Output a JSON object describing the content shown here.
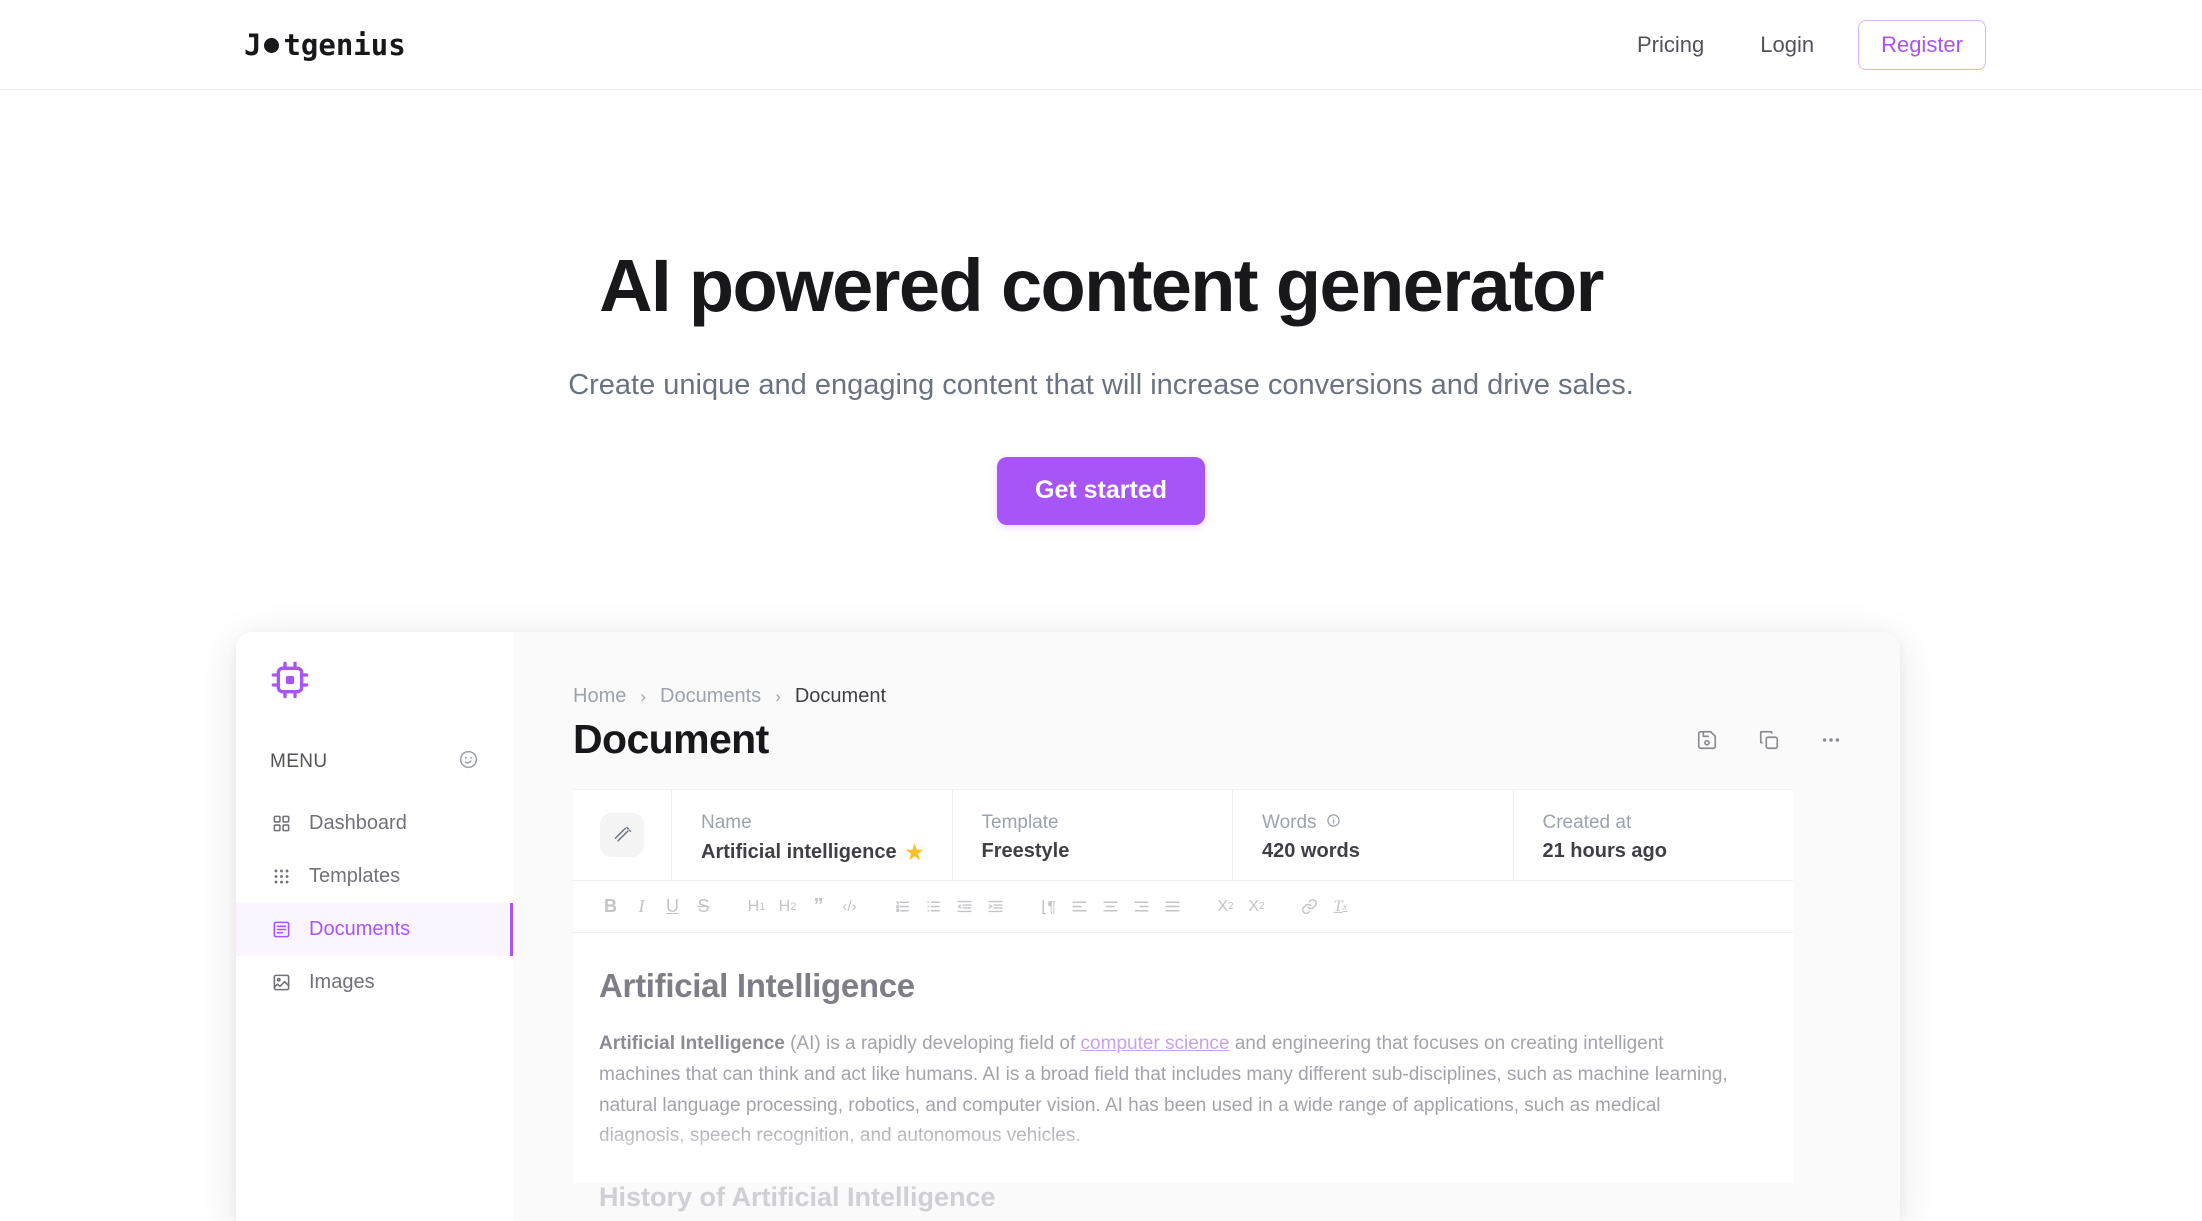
{
  "site": {
    "brand": {
      "prefix": "J",
      "o_icon": "filled-circle",
      "suffix": "tgenius"
    },
    "nav": [
      {
        "label": "Pricing",
        "name": "pricing"
      },
      {
        "label": "Login",
        "name": "login"
      }
    ],
    "register_label": "Register",
    "accent_color": "#a855f7",
    "register_border_color": "#d8b4fe"
  },
  "hero": {
    "title": "AI powered content generator",
    "subtitle": "Create unique and engaging content that will increase conversions and drive sales.",
    "cta_label": "Get started"
  },
  "app": {
    "sidebar": {
      "logo_icon": "cpu-chip-icon",
      "menu_label": "MENU",
      "menu_right_icon": "emoji-face-icon",
      "items": [
        {
          "label": "Dashboard",
          "icon": "grid-icon",
          "active": false
        },
        {
          "label": "Templates",
          "icon": "dots-grid-icon",
          "active": false
        },
        {
          "label": "Documents",
          "icon": "document-list-icon",
          "active": true
        },
        {
          "label": "Images",
          "icon": "image-icon",
          "active": false
        }
      ]
    },
    "breadcrumb": [
      {
        "label": "Home",
        "current": false
      },
      {
        "label": "Documents",
        "current": false
      },
      {
        "label": "Document",
        "current": true
      }
    ],
    "breadcrumb_separator": "›",
    "page_title": "Document",
    "actions": [
      {
        "name": "save-icon",
        "label": "Save"
      },
      {
        "name": "copy-icon",
        "label": "Copy"
      },
      {
        "name": "more-options-icon",
        "label": "More"
      }
    ],
    "info_bar": {
      "leading_icon": "magic-wand-icon",
      "fields": [
        {
          "label": "Name",
          "value": "Artificial intelligence",
          "starred": true,
          "star_glyph": "★"
        },
        {
          "label": "Template",
          "value": "Freestyle",
          "starred": false
        },
        {
          "label": "Words",
          "value": "420 words",
          "starred": false,
          "info_icon": "info-circle-icon"
        },
        {
          "label": "Created at",
          "value": "21 hours ago",
          "starred": false
        }
      ]
    },
    "toolbar": [
      {
        "name": "bold-icon",
        "glyph": "B",
        "style": "bold"
      },
      {
        "name": "italic-icon",
        "glyph": "I",
        "style": "italic"
      },
      {
        "name": "underline-icon",
        "glyph": "U",
        "style": "underline"
      },
      {
        "name": "strikethrough-icon",
        "glyph": "S",
        "style": "strike"
      },
      {
        "name": "heading-1-icon",
        "glyph": "H₁",
        "style": "plain"
      },
      {
        "name": "heading-2-icon",
        "glyph": "H₂",
        "style": "plain"
      },
      {
        "name": "blockquote-icon",
        "glyph": "”",
        "style": "plain"
      },
      {
        "name": "code-block-icon",
        "glyph": "‹›",
        "style": "plain"
      },
      {
        "name": "ordered-list-icon",
        "glyph": "☰",
        "style": "plain"
      },
      {
        "name": "bullet-list-icon",
        "glyph": "☰",
        "style": "plain"
      },
      {
        "name": "outdent-icon",
        "glyph": "☰",
        "style": "plain"
      },
      {
        "name": "indent-icon",
        "glyph": "☰",
        "style": "plain"
      },
      {
        "name": "text-direction-icon",
        "glyph": "¶",
        "style": "plain"
      },
      {
        "name": "align-left-icon",
        "glyph": "☰",
        "style": "plain"
      },
      {
        "name": "align-center-icon",
        "glyph": "☰",
        "style": "plain"
      },
      {
        "name": "align-right-icon",
        "glyph": "☰",
        "style": "plain"
      },
      {
        "name": "align-justify-icon",
        "glyph": "☰",
        "style": "plain"
      },
      {
        "name": "subscript-icon",
        "glyph": "X₂",
        "style": "plain"
      },
      {
        "name": "superscript-icon",
        "glyph": "X²",
        "style": "plain"
      },
      {
        "name": "link-icon",
        "glyph": "ὑ7",
        "style": "plain"
      },
      {
        "name": "clear-format-icon",
        "glyph": "Tₓ",
        "style": "plain"
      }
    ],
    "document": {
      "h1": "Artificial Intelligence",
      "paragraph_lead": "Artificial Intelligence",
      "paragraph_before_link": " (AI) is a rapidly developing field of ",
      "paragraph_link": "computer science",
      "paragraph_after_link": " and engineering that focuses on creating intelligent machines that can think and act like humans. AI is a broad field that includes many different sub-disciplines, such as machine learning, natural language processing, robotics, and computer vision. AI has been used in a wide range of applications, such as medical diagnosis, speech recognition, and autonomous vehicles.",
      "h2": "History of Artificial Intelligence"
    }
  }
}
